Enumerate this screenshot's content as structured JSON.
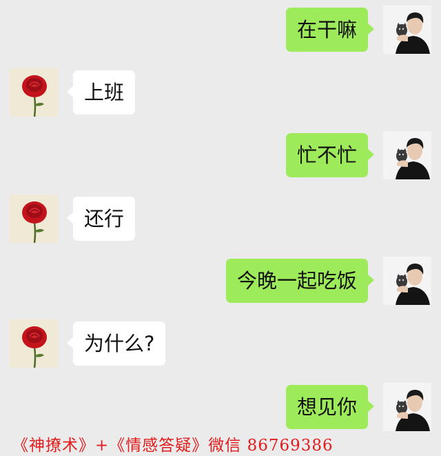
{
  "colors": {
    "background": "#ebebeb",
    "outgoing_bubble": "#9dea5a",
    "incoming_bubble": "#ffffff",
    "watermark": "#e21c1c"
  },
  "contacts": {
    "self_avatar": "man-with-cat-avatar",
    "other_avatar": "red-rose-avatar"
  },
  "messages": [
    {
      "sender": "self",
      "text": "在干嘛"
    },
    {
      "sender": "other",
      "text": "上班"
    },
    {
      "sender": "self",
      "text": "忙不忙"
    },
    {
      "sender": "other",
      "text": "还行"
    },
    {
      "sender": "self",
      "text": "今晚一起吃饭"
    },
    {
      "sender": "other",
      "text": "为什么?"
    },
    {
      "sender": "self",
      "text": "想见你"
    }
  ],
  "watermark": {
    "text": "《神撩术》+《情感答疑》微信  86769386"
  }
}
